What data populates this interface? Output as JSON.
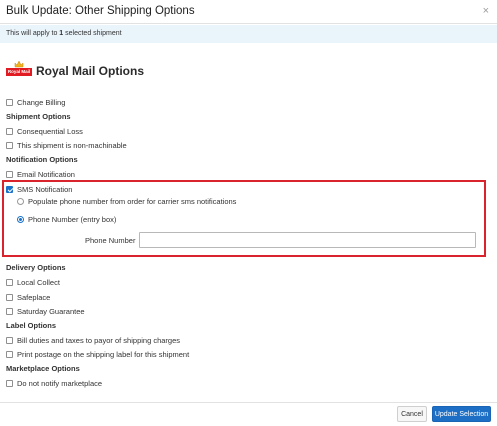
{
  "dialog": {
    "title": "Bulk Update: Other Shipping Options",
    "close_glyph": "×",
    "info_prefix": "This will apply to ",
    "info_count": "1",
    "info_suffix": " selected shipment"
  },
  "carrier": {
    "logo_text": "Royal Mail",
    "logo_color": "#e01b22",
    "title": "Royal Mail Options"
  },
  "options": {
    "change_billing": {
      "label": "Change Billing",
      "checked": false
    },
    "shipment_section": "Shipment Options",
    "consequential_loss": {
      "label": "Consequential Loss",
      "checked": false
    },
    "non_machinable": {
      "label": "This shipment is non-machinable",
      "checked": false
    },
    "notification_section": "Notification Options",
    "email_notification": {
      "label": "Email Notification",
      "checked": false
    },
    "sms_notification": {
      "label": "SMS Notification",
      "checked": true
    },
    "sms_radio_populate": {
      "label": "Populate phone number from order for carrier sms notifications",
      "selected": false
    },
    "sms_radio_entry": {
      "label": "Phone Number (entry box)",
      "selected": true
    },
    "phone_number": {
      "label": "Phone Number",
      "value": "",
      "placeholder": ""
    },
    "delivery_section": "Delivery Options",
    "local_collect": {
      "label": "Local Collect",
      "checked": false
    },
    "safeplace": {
      "label": "Safeplace",
      "checked": false
    },
    "saturday_guarantee": {
      "label": "Saturday Guarantee",
      "checked": false
    },
    "label_section": "Label Options",
    "bill_duties": {
      "label": "Bill duties and taxes to payor of shipping charges",
      "checked": false
    },
    "print_postage": {
      "label": "Print postage on the shipping label for this shipment",
      "checked": false
    },
    "marketplace_section": "Marketplace Options",
    "do_not_notify": {
      "label": "Do not notify marketplace",
      "checked": false
    }
  },
  "footer": {
    "cancel_label": "Cancel",
    "update_label": "Update Selection"
  },
  "colors": {
    "accent": "#1d6fc6",
    "highlight_border": "#d9232d",
    "info_bg": "#eaf4fb"
  }
}
